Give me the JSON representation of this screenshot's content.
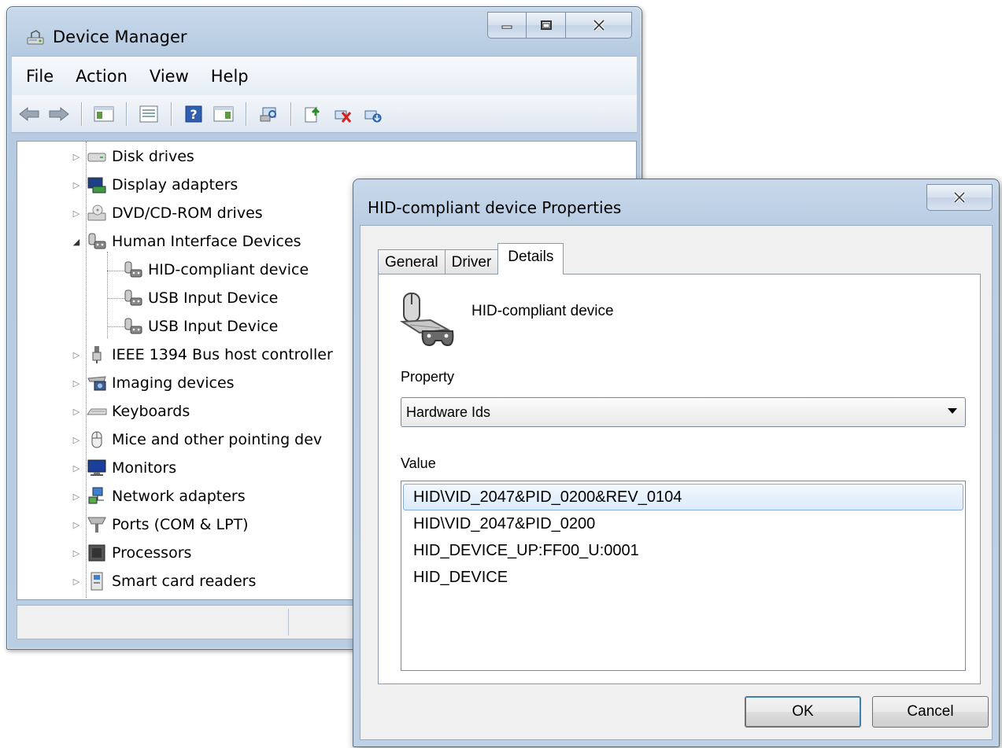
{
  "device_manager": {
    "title": "Device Manager",
    "caption_buttons": {
      "minimize": "minimize-icon",
      "maximize": "maximize-icon",
      "close": "close-icon"
    },
    "menu": [
      "File",
      "Action",
      "View",
      "Help"
    ],
    "toolbar": [
      "back-icon",
      "forward-icon",
      "show-hide-console-tree-icon",
      "properties-icon",
      "help-icon",
      "show-hide-action-pane-icon",
      "scan-hardware-icon",
      "update-driver-icon",
      "uninstall-icon",
      "enable-device-icon"
    ],
    "tree": [
      {
        "label": "Disk drives",
        "icon": "disk-drive-icon",
        "state": "collapsed"
      },
      {
        "label": "Display adapters",
        "icon": "display-adapter-icon",
        "state": "collapsed"
      },
      {
        "label": "DVD/CD-ROM drives",
        "icon": "dvd-drive-icon",
        "state": "collapsed"
      },
      {
        "label": "Human Interface Devices",
        "icon": "hid-icon",
        "state": "expanded"
      },
      {
        "label": "HID-compliant device",
        "icon": "hid-icon",
        "state": "child"
      },
      {
        "label": "USB Input Device",
        "icon": "hid-icon",
        "state": "child"
      },
      {
        "label": "USB Input Device",
        "icon": "hid-icon",
        "state": "child"
      },
      {
        "label": "IEEE 1394 Bus host controller",
        "icon": "ieee1394-icon",
        "state": "collapsed"
      },
      {
        "label": "Imaging devices",
        "icon": "imaging-icon",
        "state": "collapsed"
      },
      {
        "label": "Keyboards",
        "icon": "keyboard-icon",
        "state": "collapsed"
      },
      {
        "label": "Mice and other pointing dev",
        "icon": "mouse-icon",
        "state": "collapsed"
      },
      {
        "label": "Monitors",
        "icon": "monitor-icon",
        "state": "collapsed"
      },
      {
        "label": "Network adapters",
        "icon": "network-icon",
        "state": "collapsed"
      },
      {
        "label": "Ports (COM & LPT)",
        "icon": "port-icon",
        "state": "collapsed"
      },
      {
        "label": "Processors",
        "icon": "processor-icon",
        "state": "collapsed"
      },
      {
        "label": "Smart card readers",
        "icon": "smartcard-icon",
        "state": "collapsed"
      }
    ]
  },
  "properties_dialog": {
    "title": "HID-compliant device Properties",
    "tabs": [
      "General",
      "Driver",
      "Details"
    ],
    "active_tab": "Details",
    "device_name": "HID-compliant device",
    "property_label": "Property",
    "property_selected": "Hardware Ids",
    "value_label": "Value",
    "values": [
      "HID\\VID_2047&PID_0200&REV_0104",
      "HID\\VID_2047&PID_0200",
      "HID_DEVICE_UP:FF00_U:0001",
      "HID_DEVICE"
    ],
    "selected_value_index": 0,
    "ok_label": "OK",
    "cancel_label": "Cancel"
  }
}
